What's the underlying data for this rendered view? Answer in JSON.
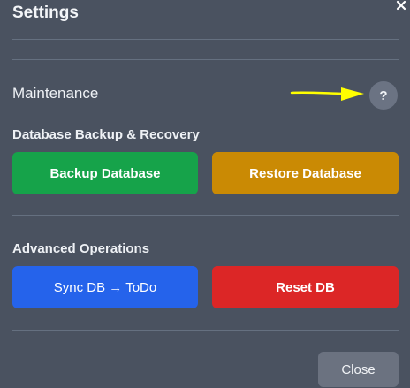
{
  "dialog": {
    "title": "Settings",
    "close_icon": "close-x-icon"
  },
  "maintenance": {
    "heading": "Maintenance",
    "help_label": "?",
    "annotation_color": "#ffff00"
  },
  "backup_section": {
    "heading": "Database Backup & Recovery",
    "backup_label": "Backup Database",
    "restore_label": "Restore Database"
  },
  "advanced_section": {
    "heading": "Advanced Operations",
    "sync_label": "Sync DB → ToDo",
    "reset_label": "Reset DB"
  },
  "footer": {
    "close_label": "Close"
  },
  "colors": {
    "background": "#4a5260",
    "green": "#16a34a",
    "amber": "#ca8a04",
    "blue": "#2563eb",
    "red": "#dc2626",
    "gray": "#6b7280"
  }
}
